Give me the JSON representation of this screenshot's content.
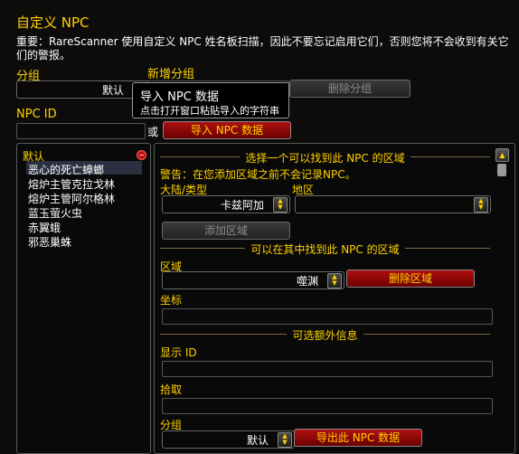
{
  "window": {
    "title": "自定义 NPC",
    "warning": "重要：RareScanner 使用自定义 NPC 姓名板扫描，因此不要忘记启用它们，否则您将不会收到有关它们的警报。"
  },
  "group": {
    "label": "分组",
    "selected": "默认",
    "new_group_label": "新增分组",
    "delete_label": "删除分组"
  },
  "tooltip": {
    "title": "导入 NPC 数据",
    "text": "点击打开窗口粘贴导入的字符串"
  },
  "npc_id": {
    "label": "NPC ID",
    "value": "",
    "or_label": "或",
    "import_label": "导入 NPC 数据"
  },
  "npc_list": {
    "group_header": "默认",
    "items": [
      "恶心的死亡蟑螂",
      "熔炉主管克拉戈林",
      "熔炉主管阿尔格林",
      "蓝玉萤火虫",
      "赤翼蛾",
      "邪恶巢蛛"
    ]
  },
  "form": {
    "section_zone": "选择一个可以找到此 NPC 的区域",
    "zone_warning": "警告：在您添加区域之前不会记录NPC。",
    "continent_label": "大陆/类型",
    "continent_value": "卡兹阿加",
    "zone_label": "地区",
    "zone_value": "",
    "add_zone_label": "添加区域",
    "section_found": "可以在其中找到此 NPC 的区域",
    "area_label": "区域",
    "area_value": "噬渊",
    "delete_zone_label": "删除区域",
    "coords_label": "坐标",
    "section_optional": "可选额外信息",
    "display_id_label": "显示 ID",
    "loot_label": "拾取",
    "group_label": "分组",
    "group_value": "默认",
    "export_label": "导出此 NPC 数据"
  }
}
